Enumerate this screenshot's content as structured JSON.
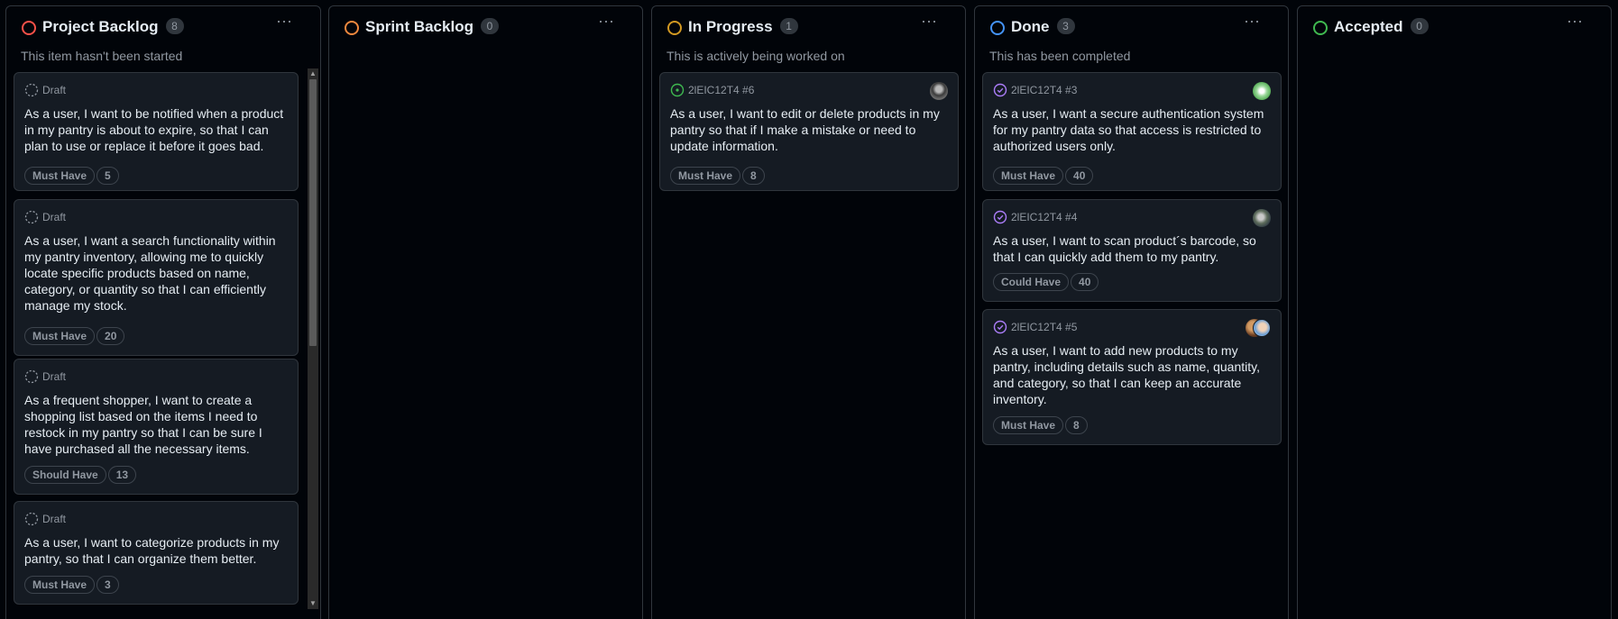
{
  "columns": [
    {
      "title": "Project Backlog",
      "count": "8",
      "description": "This item hasn't been started",
      "status_color": "#f85149",
      "cards": [
        {
          "meta": "Draft",
          "meta_icon": "draft-icon",
          "text": "As a user, I want to be notified when a product in my pantry is about to expire, so that I can plan to use or replace it before it goes bad.",
          "labels": [
            "Must Have",
            "5"
          ]
        },
        {
          "meta": "Draft",
          "meta_icon": "draft-icon",
          "text": "As a user, I want a search functionality within my pantry inventory, allowing me to quickly locate specific products based on name, category, or quantity so that I can efficiently manage my stock.",
          "labels": [
            "Must Have",
            "20"
          ]
        },
        {
          "meta": "Draft",
          "meta_icon": "draft-icon",
          "text": "As a frequent shopper, I want to create a shopping list based on the items I need to restock in my pantry so that I can be sure I have purchased all the necessary items.",
          "labels": [
            "Should Have",
            "13"
          ]
        },
        {
          "meta": "Draft",
          "meta_icon": "draft-icon",
          "text": "As a user, I want to categorize products in my pantry, so that I can organize them better.",
          "labels": [
            "Must Have",
            "3"
          ]
        }
      ]
    },
    {
      "title": "Sprint Backlog",
      "count": "0",
      "description": "",
      "status_color": "#f0883e",
      "cards": []
    },
    {
      "title": "In Progress",
      "count": "1",
      "description": "This is actively being worked on",
      "status_color": "#d29922",
      "cards": [
        {
          "meta": "2lEIC12T4 #6",
          "meta_icon": "open-issue-icon",
          "text": "As a user, I want to edit or delete products in my pantry so that if I make a mistake or need to update information.",
          "labels": [
            "Must Have",
            "8"
          ]
        }
      ]
    },
    {
      "title": "Done",
      "count": "3",
      "description": "This has been completed",
      "status_color": "#4493f8",
      "cards": [
        {
          "meta": "2lEIC12T4 #3",
          "meta_icon": "closed-issue-icon",
          "text": "As a user, I want a secure authentication system for my pantry data so that access is restricted to authorized users only.",
          "labels": [
            "Must Have",
            "40"
          ]
        },
        {
          "meta": "2lEIC12T4 #4",
          "meta_icon": "closed-issue-icon",
          "text": "As a user, I want to scan product´s barcode, so that I can quickly add them to my pantry.",
          "labels": [
            "Could Have",
            "40"
          ]
        },
        {
          "meta": "2lEIC12T4 #5",
          "meta_icon": "closed-issue-icon",
          "text": "As a user, I want to add new products to my pantry, including details such as name, quantity, and category, so that I can keep an accurate inventory.",
          "labels": [
            "Must Have",
            "8"
          ]
        }
      ]
    },
    {
      "title": "Accepted",
      "count": "0",
      "description": "",
      "status_color": "#3fb950",
      "cards": []
    }
  ],
  "menu_glyph": "···",
  "colors": {
    "background": "#010409",
    "card": "#151b23",
    "border": "#30363d",
    "muted_text": "#9198a1",
    "open_issue": "#3fb950",
    "closed_issue": "#ab7df8"
  }
}
